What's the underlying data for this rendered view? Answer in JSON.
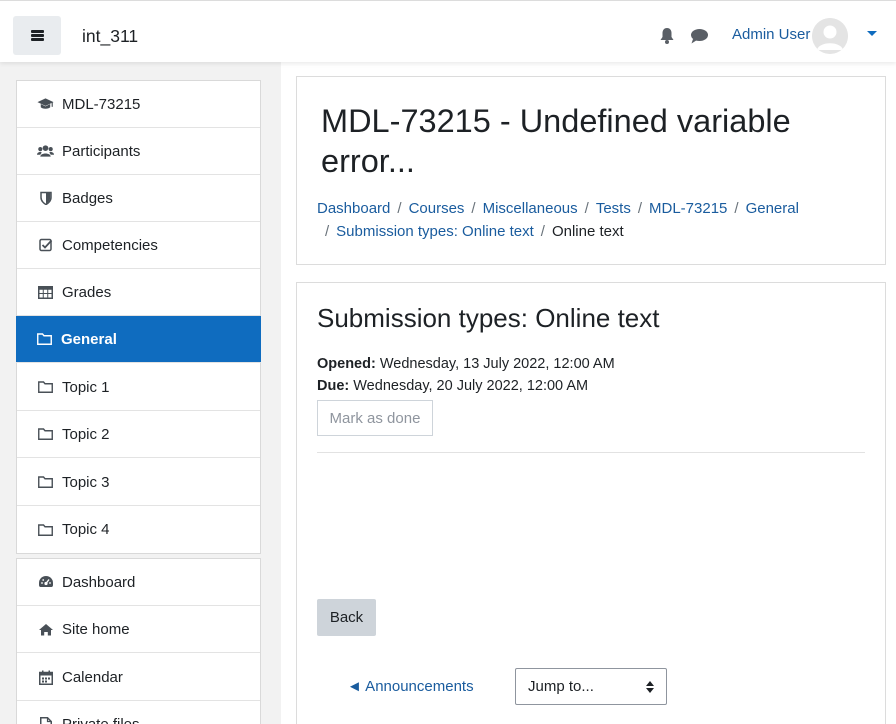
{
  "header": {
    "site_name": "int_311",
    "user_name": "Admin User",
    "icons": [
      "menu-icon",
      "bell-icon",
      "chat-icon",
      "avatar",
      "chevron-down-icon"
    ]
  },
  "nav": {
    "course_items": [
      {
        "label": "MDL-73215",
        "icon": "graduation-cap-icon"
      },
      {
        "label": "Participants",
        "icon": "users-icon"
      },
      {
        "label": "Badges",
        "icon": "shield-icon"
      },
      {
        "label": "Competencies",
        "icon": "checkbox-icon"
      },
      {
        "label": "Grades",
        "icon": "table-icon"
      },
      {
        "label": "General",
        "icon": "folder-icon",
        "active": true
      },
      {
        "label": "Topic 1",
        "icon": "folder-icon"
      },
      {
        "label": "Topic 2",
        "icon": "folder-icon"
      },
      {
        "label": "Topic 3",
        "icon": "folder-icon"
      },
      {
        "label": "Topic 4",
        "icon": "folder-icon"
      }
    ],
    "site_items": [
      {
        "label": "Dashboard",
        "icon": "dashboard-icon"
      },
      {
        "label": "Site home",
        "icon": "home-icon"
      },
      {
        "label": "Calendar",
        "icon": "calendar-icon"
      },
      {
        "label": "Private files",
        "icon": "file-icon"
      }
    ]
  },
  "page": {
    "title": "MDL-73215 - Undefined variable error...",
    "breadcrumb": [
      "Dashboard",
      "Courses",
      "Miscellaneous",
      "Tests",
      "MDL-73215",
      "General",
      "Submission types: Online text",
      "Online text"
    ]
  },
  "activity": {
    "title": "Submission types: Online text",
    "opened_label": "Opened:",
    "opened_value": " Wednesday, 13 July 2022, 12:00 AM",
    "due_label": "Due:",
    "due_value": " Wednesday, 20 July 2022, 12:00 AM",
    "mark_done": "Mark as done",
    "back": "Back",
    "prev_activity": "◄ Announcements",
    "jump_to": "Jump to..."
  },
  "colors": {
    "accent": "#0f6cbf",
    "link": "#1a5c9e",
    "button_secondary": "#ced4da"
  }
}
